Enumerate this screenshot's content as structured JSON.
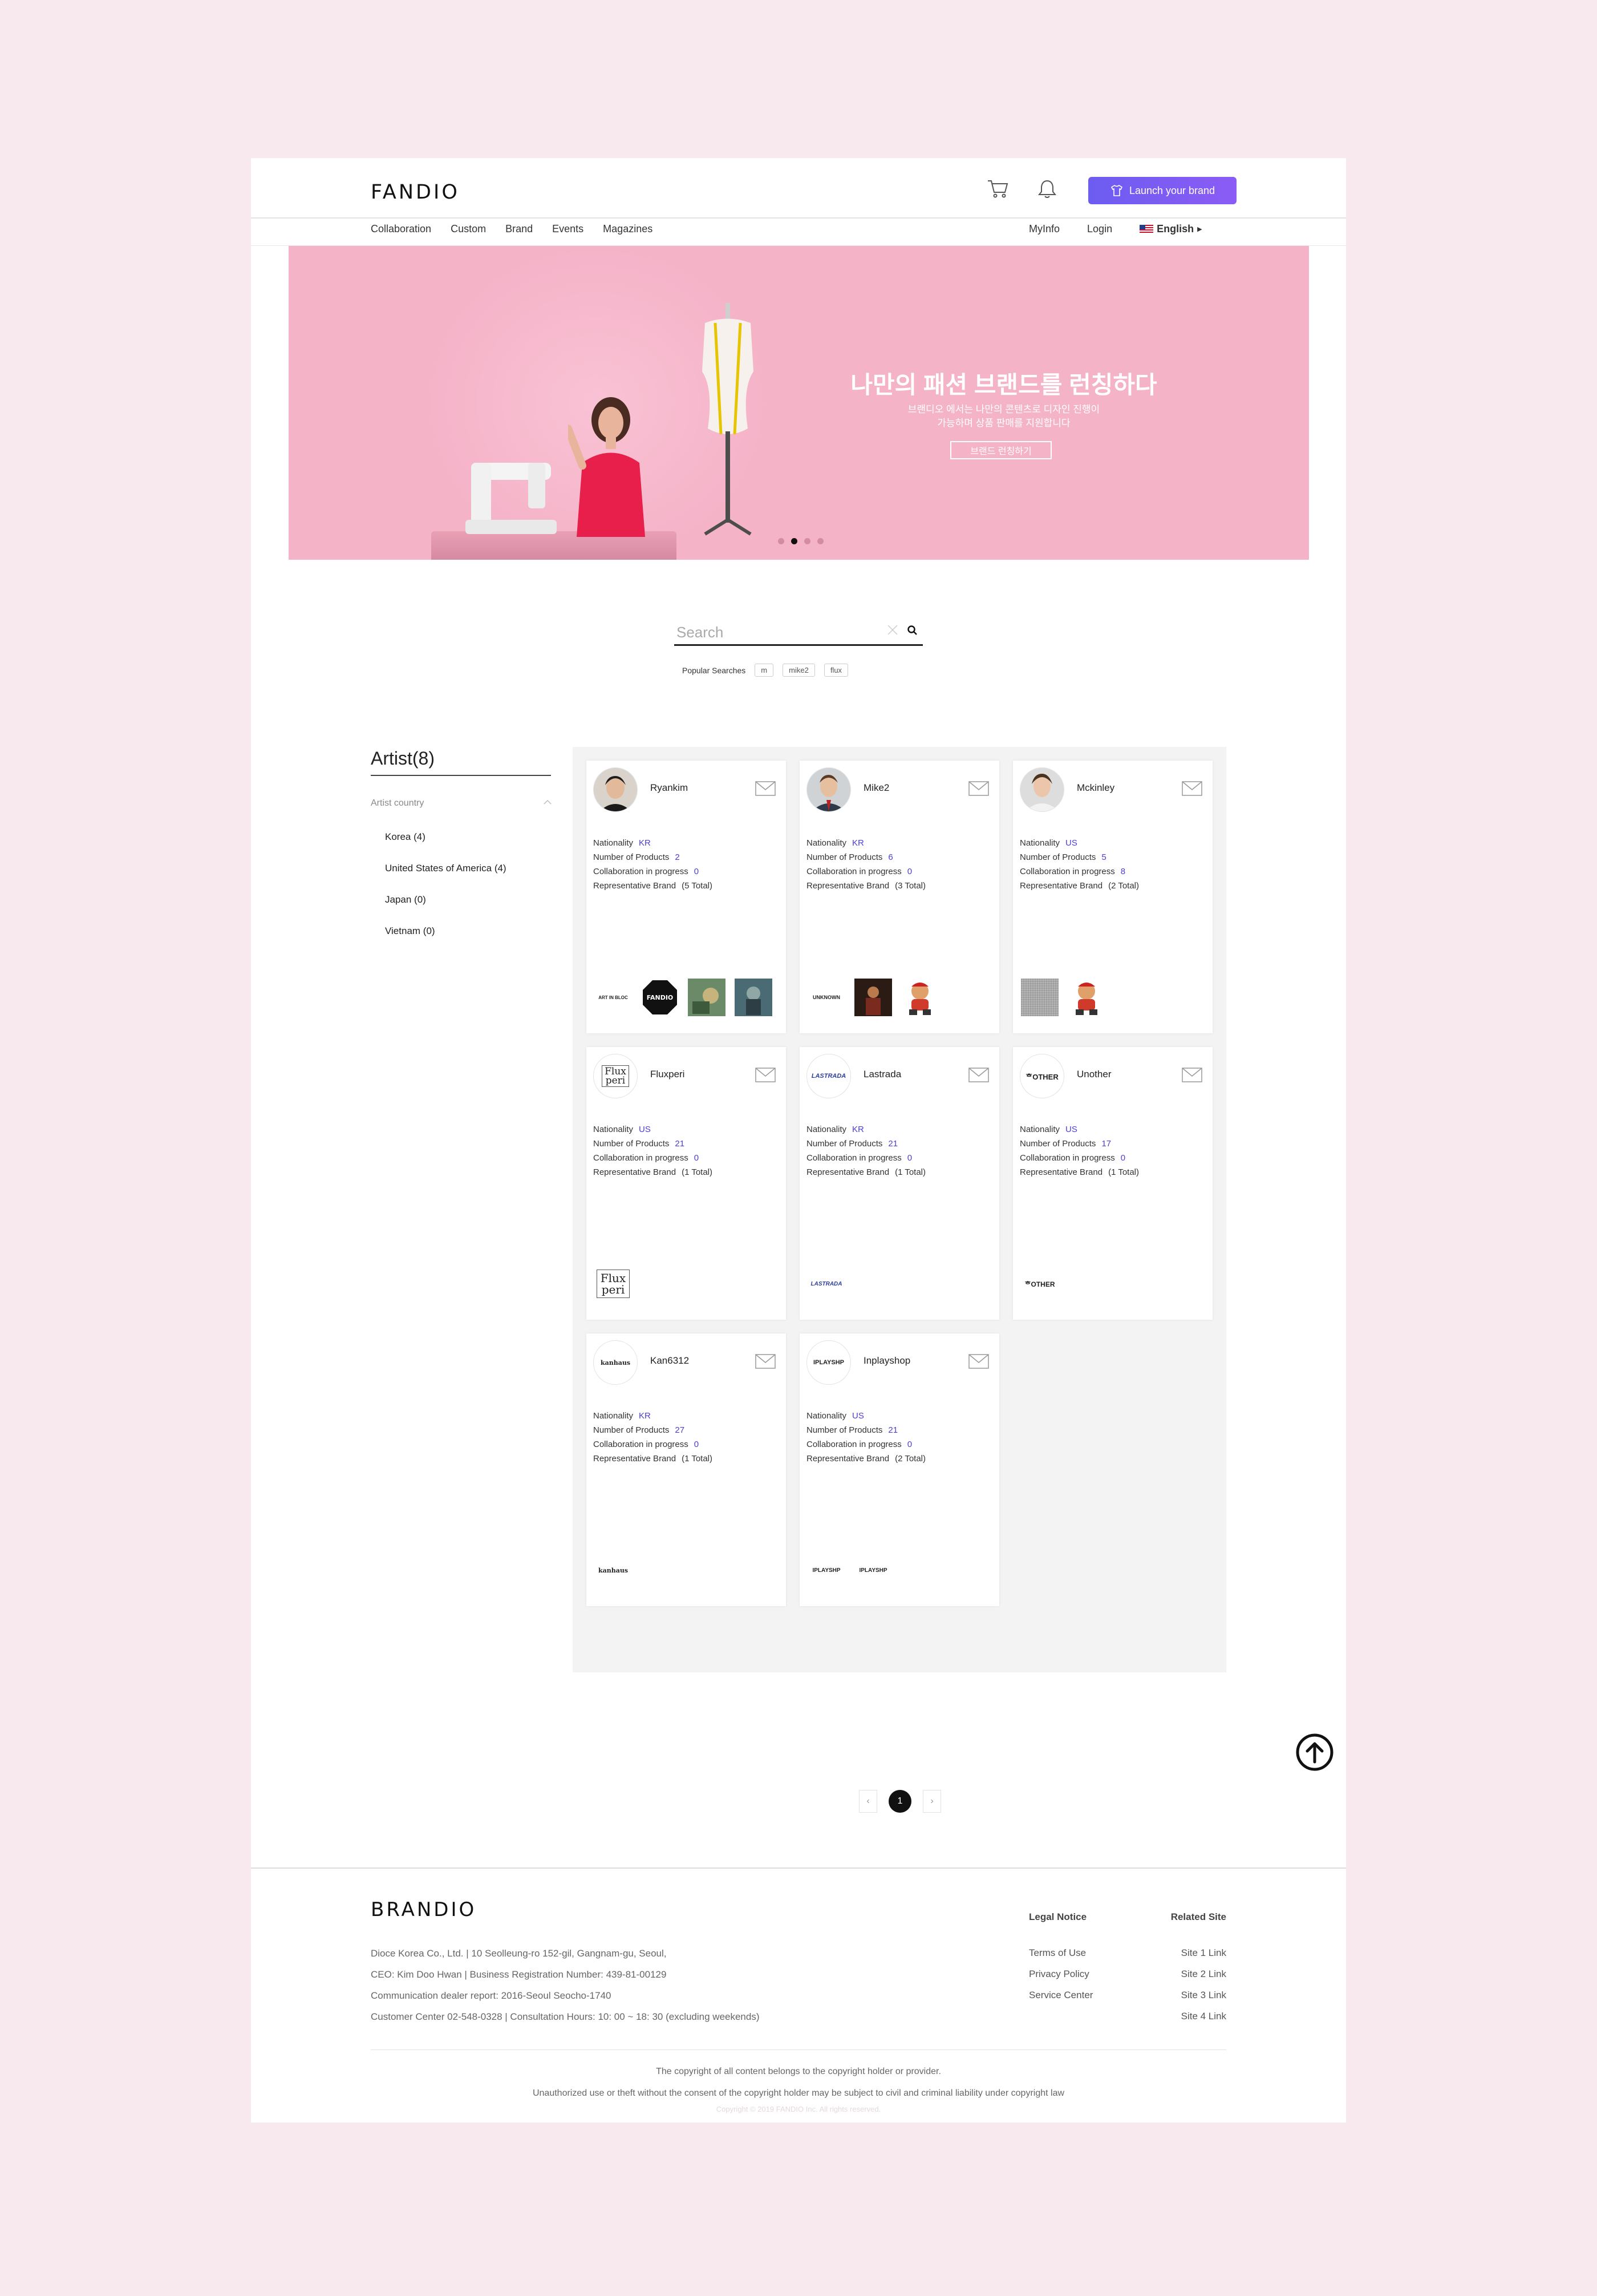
{
  "header": {
    "logo": "FANDIO",
    "launch_label": "Launch your brand",
    "nav": [
      "Collaboration",
      "Custom",
      "Brand",
      "Events",
      "Magazines"
    ],
    "myinfo": "MyInfo",
    "login": "Login",
    "language": "English"
  },
  "hero": {
    "title": "나만의 패션 브랜드를 런칭하다",
    "subtitle": "브랜디오 에서는 나만의 콘텐츠로 디자인 진행이\n가능하며 상품 판매를 지원합니다",
    "button": "브랜드 런칭하기",
    "slides": 4,
    "active_slide": 2
  },
  "search": {
    "placeholder": "Search",
    "popular_label": "Popular Searches",
    "popular": [
      "m",
      "mike2",
      "flux"
    ]
  },
  "sidebar": {
    "title": "Artist(8)",
    "filter_label": "Artist country",
    "countries": [
      "Korea (4)",
      "United States of America (4)",
      "Japan (0)",
      "Vietnam (0)"
    ]
  },
  "labels": {
    "nationality": "Nationality",
    "products": "Number of Products",
    "collab": "Collaboration in progress",
    "brand": "Representative Brand"
  },
  "artists": [
    {
      "name": "Ryankim",
      "nationality": "KR",
      "products": "2",
      "collab": "0",
      "brands_total": "(5 Total)"
    },
    {
      "name": "Mike2",
      "nationality": "KR",
      "products": "6",
      "collab": "0",
      "brands_total": "(3 Total)"
    },
    {
      "name": "Mckinley",
      "nationality": "US",
      "products": "5",
      "collab": "8",
      "brands_total": "(2 Total)"
    },
    {
      "name": "Fluxperi",
      "nationality": "US",
      "products": "21",
      "collab": "0",
      "brands_total": "(1 Total)"
    },
    {
      "name": "Lastrada",
      "nationality": "KR",
      "products": "21",
      "collab": "0",
      "brands_total": "(1 Total)"
    },
    {
      "name": "Unother",
      "nationality": "US",
      "products": "17",
      "collab": "0",
      "brands_total": "(1 Total)"
    },
    {
      "name": "Kan6312",
      "nationality": "KR",
      "products": "27",
      "collab": "0",
      "brands_total": "(1 Total)"
    },
    {
      "name": "Inplayshop",
      "nationality": "US",
      "products": "21",
      "collab": "0",
      "brands_total": "(2 Total)"
    }
  ],
  "brand_marks": {
    "artinblok": "ART IN BLOC",
    "fandio": "FANDIO",
    "unknown": "UNKNOWN",
    "flux": "Flux\nperi",
    "lastrada": "LASTRADA",
    "unother": "ᄒOTHER",
    "kan": "kanhaus",
    "inplay": "IPLAYSHP"
  },
  "pagination": {
    "current": "1",
    "prev": "‹",
    "next": "›"
  },
  "footer": {
    "logo": "BRANDIO",
    "info": [
      "Dioce Korea Co., Ltd. | 10 Seolleung-ro 152-gil, Gangnam-gu, Seoul,",
      "CEO: Kim Doo Hwan | Business Registration Number: 439-81-00129",
      "Communication dealer report: 2016-Seoul Seocho-1740",
      "Customer Center 02-548-0328 | Consultation Hours: 10: 00 ~ 18: 30 (excluding weekends)"
    ],
    "legal_head": "Legal Notice",
    "legal": [
      "Terms of Use",
      "Privacy Policy",
      "Service Center"
    ],
    "related_head": "Related Site",
    "related": [
      "Site 1 Link",
      "Site 2 Link",
      "Site 3 Link",
      "Site 4 Link"
    ],
    "copy1": "The copyright of all content belongs to the copyright holder or provider.",
    "copy2": "Unauthorized use or theft without the consent of the copyright holder may be subject to civil and criminal liability under copyright law",
    "copy3": "Copyright © 2019 FANDIO Inc. All rights reserved."
  },
  "colors": {
    "accent": "#6d5cf0",
    "hero_bg": "#f5b3c8",
    "page_bg": "#f7e9ee",
    "value": "#4b3fd6"
  }
}
